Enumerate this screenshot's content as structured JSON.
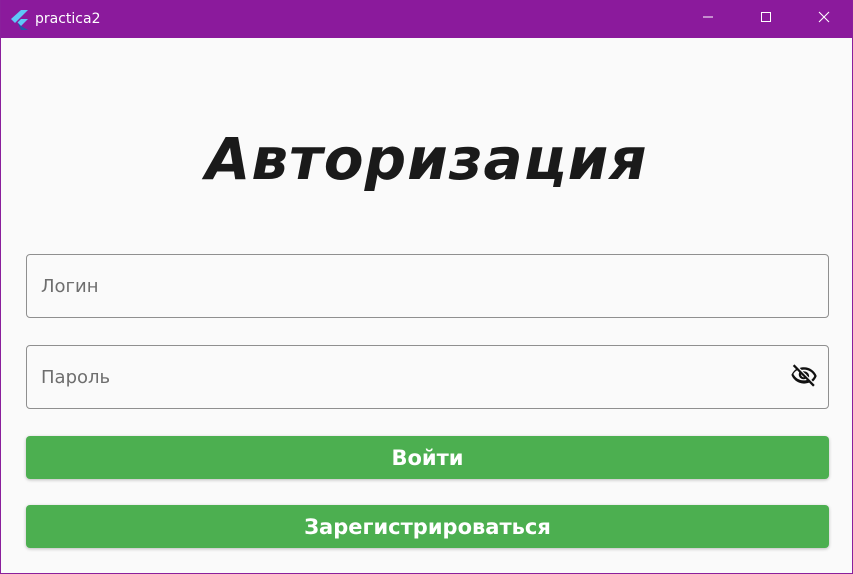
{
  "window": {
    "title": "practica2",
    "titlebar_color": "#8b1a9c",
    "icons": {
      "app": "flutter-logo-icon",
      "minimize": "minimize-icon",
      "maximize": "maximize-icon",
      "close": "close-icon"
    }
  },
  "page": {
    "heading": "Авторизация"
  },
  "form": {
    "login": {
      "placeholder": "Логин",
      "value": ""
    },
    "password": {
      "placeholder": "Пароль",
      "value": "",
      "toggle_icon": "visibility-off-icon"
    }
  },
  "actions": {
    "login_label": "Войти",
    "register_label": "Зарегистрироваться",
    "button_color": "#4caf50"
  }
}
